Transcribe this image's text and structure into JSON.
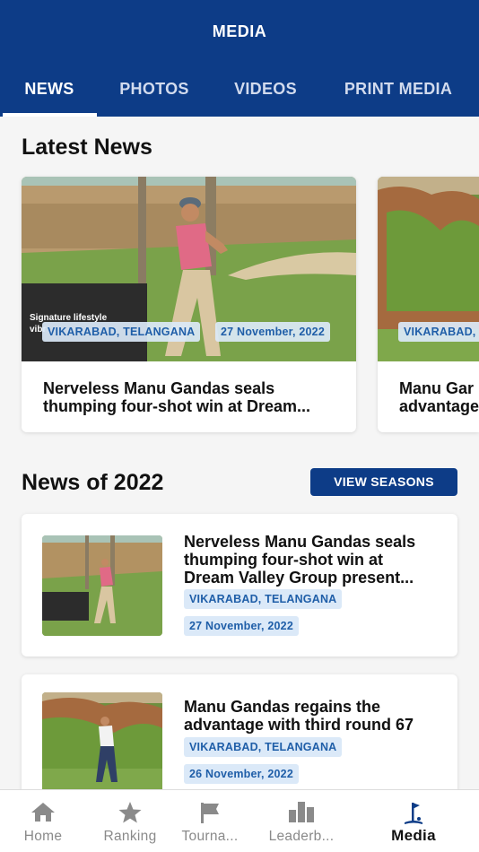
{
  "header": {
    "title": "MEDIA"
  },
  "tabs": [
    {
      "label": "NEWS",
      "active": true
    },
    {
      "label": "PHOTOS",
      "active": false
    },
    {
      "label": "VIDEOS",
      "active": false
    },
    {
      "label": "PRINT MEDIA",
      "active": false
    }
  ],
  "latest": {
    "title": "Latest News",
    "cards": [
      {
        "location": "VIKARABAD, TELANGANA",
        "date": "27 November, 2022",
        "headline_line1": "Nerveless Manu Gandas seals",
        "headline_line2": "thumping four-shot win at Dream...",
        "banner_text_1": "Signature lifestyle",
        "banner_text_2": "vibr"
      },
      {
        "location": "VIKARABAD, T",
        "headline_line1": "Manu Gar",
        "headline_line2": "advantage"
      }
    ]
  },
  "season": {
    "title": "News of 2022",
    "button_label": "VIEW SEASONS",
    "items": [
      {
        "title_line1": "Nerveless Manu Gandas seals",
        "title_line2": "thumping four-shot win at",
        "title_line3": "Dream Valley Group present...",
        "location": "VIKARABAD, TELANGANA",
        "date": "27 November, 2022"
      },
      {
        "title_line1": "Manu Gandas regains the",
        "title_line2": "advantage with third round 67",
        "location": "VIKARABAD, TELANGANA",
        "date": "26 November, 2022"
      }
    ]
  },
  "nav": [
    {
      "label": "Home",
      "icon": "home-icon"
    },
    {
      "label": "Ranking",
      "icon": "star-icon"
    },
    {
      "label": "Tourna...",
      "icon": "flag-icon"
    },
    {
      "label": "Leaderb...",
      "icon": "bar-chart-icon"
    },
    {
      "label": "Media",
      "icon": "golf-flag-icon",
      "active": true
    }
  ],
  "colors": {
    "brand": "#0d3c87",
    "tag_bg": "#dbe9f8",
    "tag_text": "#1f5ea8"
  }
}
